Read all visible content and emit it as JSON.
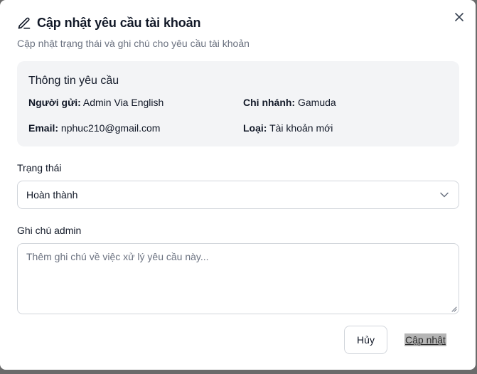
{
  "dialog": {
    "title": "Cập nhật yêu cầu tài khoản",
    "subtitle": "Cập nhật trạng thái và ghi chú cho yêu cầu tài khoản"
  },
  "request_info": {
    "heading": "Thông tin yêu cầu",
    "sender_label": "Người gửi:",
    "sender_value": "Admin Via English",
    "branch_label": "Chi nhánh:",
    "branch_value": "Gamuda",
    "email_label": "Email:",
    "email_value": "nphuc210@gmail.com",
    "type_label": "Loại:",
    "type_value": "Tài khoản mới"
  },
  "status": {
    "label": "Trạng thái",
    "selected": "Hoàn thành"
  },
  "admin_note": {
    "label": "Ghi chú admin",
    "placeholder": "Thêm ghi chú về việc xử lý yêu cầu này...",
    "value": ""
  },
  "actions": {
    "cancel_label": "Hủy",
    "update_label": "Cập nhật"
  },
  "icons": {
    "title_icon": "pencil-icon",
    "close_icon": "close-icon",
    "select_icon": "chevron-down-icon"
  }
}
